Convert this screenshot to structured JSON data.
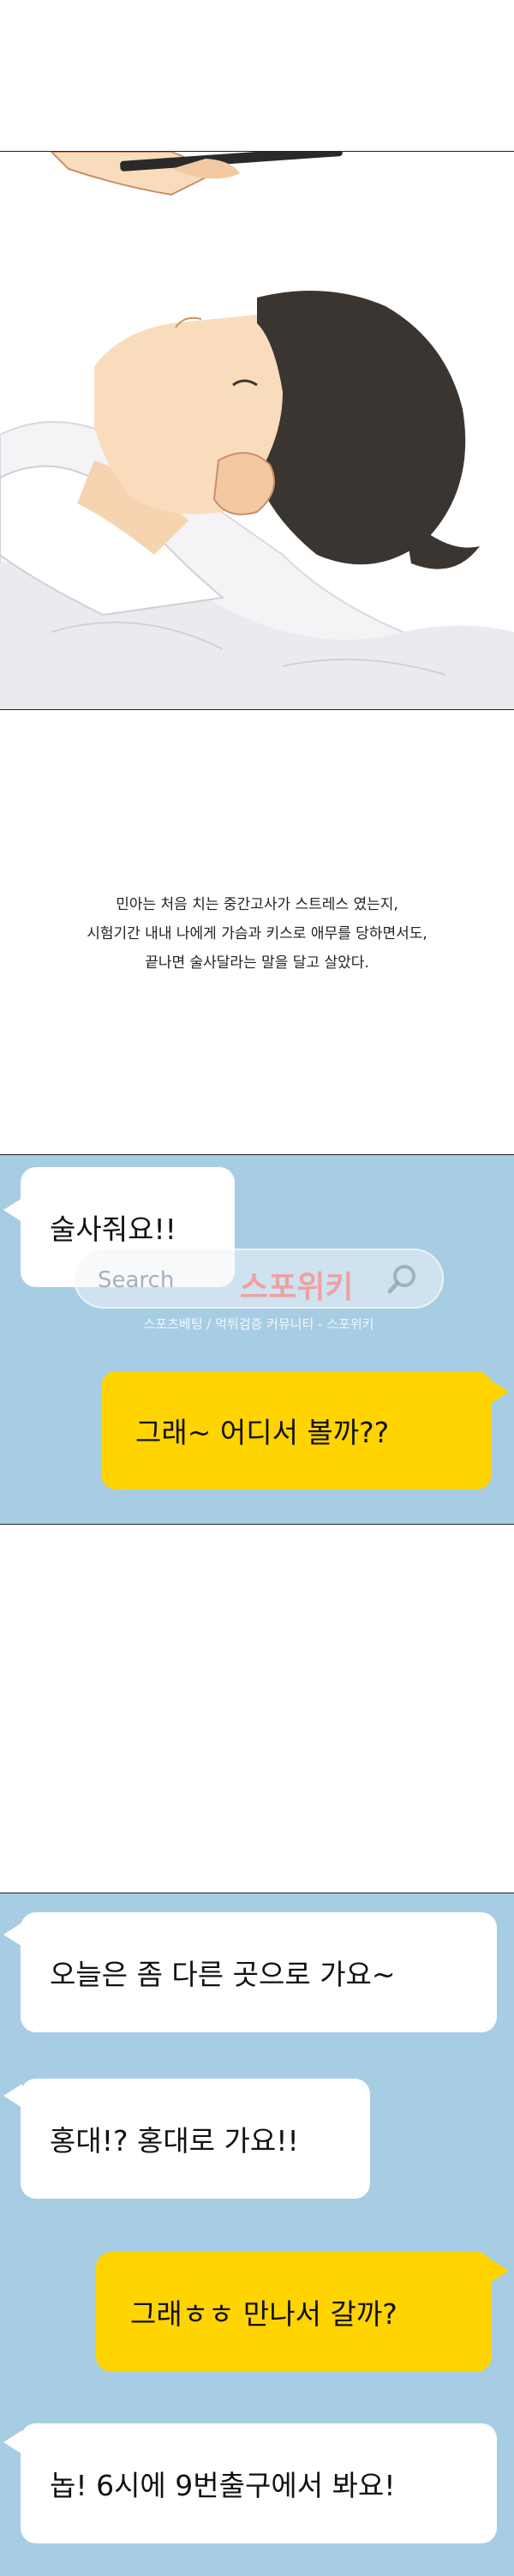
{
  "caption": {
    "line1": "민아는 처음 치는 중간고사가 스트레스 였는지,",
    "line2": "시험기간 내내 나에게 가슴과 키스로 애무를 당하면서도,",
    "line3": "끝나면 술사달라는 말을 달고 살았다."
  },
  "chat1": {
    "msg1": "술사줘요!!",
    "msg2": "그래~ 어디서 볼까??"
  },
  "watermark": {
    "placeholder": "Search",
    "brand": "스포위키",
    "subtitle": "스포츠베팅 / 먹튀검증 커뮤니티 - 스포위키"
  },
  "chat2": {
    "msg1": "오늘은 좀 다른 곳으로 가요~",
    "msg2": "홍대!? 홍대로 가요!!",
    "msg3": "그래ㅎㅎ 만나서 갈까?",
    "msg4": "놉! 6시에 9번출구에서 봐요!"
  },
  "colors": {
    "chat_background": "#a7cde4",
    "incoming_bubble": "#ffffff",
    "outgoing_bubble": "#ffd400"
  }
}
